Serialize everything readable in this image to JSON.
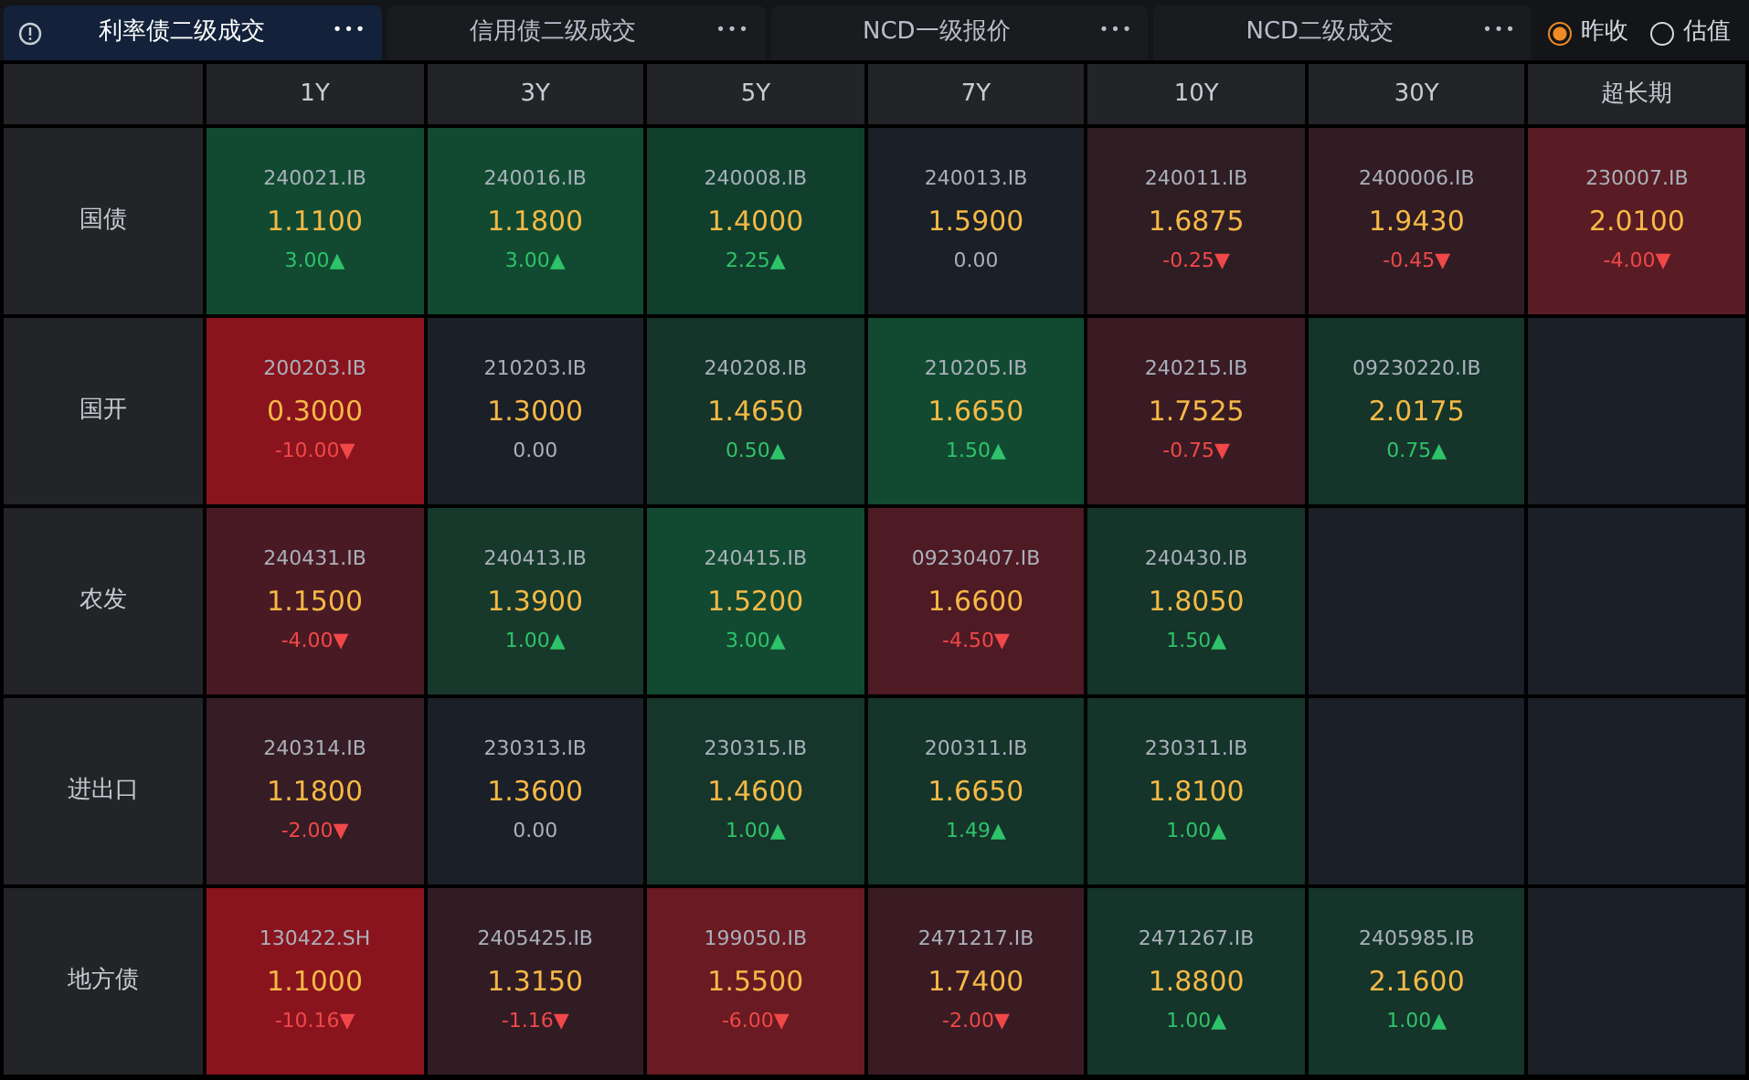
{
  "tabs": [
    {
      "label": "利率债二级成交",
      "more": "•••",
      "selected": true,
      "alert": true
    },
    {
      "label": "信用债二级成交",
      "more": "•••",
      "selected": false,
      "alert": false
    },
    {
      "label": "NCD一级报价",
      "more": "•••",
      "selected": false,
      "alert": false
    },
    {
      "label": "NCD二级成交",
      "more": "•••",
      "selected": false,
      "alert": false
    }
  ],
  "price_basis": [
    {
      "label": "昨收",
      "selected": true
    },
    {
      "label": "估值",
      "selected": false
    }
  ],
  "columns": [
    "1Y",
    "3Y",
    "5Y",
    "7Y",
    "10Y",
    "30Y",
    "超长期"
  ],
  "rows": [
    {
      "label": "国债",
      "cells": [
        {
          "code": "240021.IB",
          "yield": "1.1100",
          "change": "3.00▲",
          "kind": "up",
          "color": "#114a31"
        },
        {
          "code": "240016.IB",
          "yield": "1.1800",
          "change": "3.00▲",
          "kind": "up",
          "color": "#114a31"
        },
        {
          "code": "240008.IB",
          "yield": "1.4000",
          "change": "2.25▲",
          "kind": "up",
          "color": "#103f2d"
        },
        {
          "code": "240013.IB",
          "yield": "1.5900",
          "change": "0.00",
          "kind": "flat",
          "color": "#1b1f27"
        },
        {
          "code": "240011.IB",
          "yield": "1.6875",
          "change": "-0.25▼",
          "kind": "down",
          "color": "#2f1d24"
        },
        {
          "code": "2400006.IB",
          "yield": "1.9430",
          "change": "-0.45▼",
          "kind": "down",
          "color": "#321c24"
        },
        {
          "code": "230007.IB",
          "yield": "2.0100",
          "change": "-4.00▼",
          "kind": "down",
          "color": "#5a1c24"
        }
      ]
    },
    {
      "label": "国开",
      "cells": [
        {
          "code": "200203.IB",
          "yield": "0.3000",
          "change": "-10.00▼",
          "kind": "down",
          "color": "#8a141e"
        },
        {
          "code": "210203.IB",
          "yield": "1.3000",
          "change": "0.00",
          "kind": "flat",
          "color": "#1b1f27"
        },
        {
          "code": "240208.IB",
          "yield": "1.4650",
          "change": "0.50▲",
          "kind": "up",
          "color": "#15342a"
        },
        {
          "code": "210205.IB",
          "yield": "1.6650",
          "change": "1.50▲",
          "kind": "up",
          "color": "#114a31"
        },
        {
          "code": "240215.IB",
          "yield": "1.7525",
          "change": "-0.75▼",
          "kind": "down",
          "color": "#3a1b24"
        },
        {
          "code": "09230220.IB",
          "yield": "2.0175",
          "change": "0.75▲",
          "kind": "up",
          "color": "#15342a"
        }
      ]
    },
    {
      "label": "农发",
      "cells": [
        {
          "code": "240431.IB",
          "yield": "1.1500",
          "change": "-4.00▼",
          "kind": "down",
          "color": "#4a1a24"
        },
        {
          "code": "240413.IB",
          "yield": "1.3900",
          "change": "1.00▲",
          "kind": "up",
          "color": "#17392c"
        },
        {
          "code": "240415.IB",
          "yield": "1.5200",
          "change": "3.00▲",
          "kind": "up",
          "color": "#114a31"
        },
        {
          "code": "09230407.IB",
          "yield": "1.6600",
          "change": "-4.50▼",
          "kind": "down",
          "color": "#4e1a24"
        },
        {
          "code": "240430.IB",
          "yield": "1.8050",
          "change": "1.50▲",
          "kind": "up",
          "color": "#15342a"
        }
      ]
    },
    {
      "label": "进出口",
      "cells": [
        {
          "code": "240314.IB",
          "yield": "1.1800",
          "change": "-2.00▼",
          "kind": "down",
          "color": "#361c24"
        },
        {
          "code": "230313.IB",
          "yield": "1.3600",
          "change": "0.00",
          "kind": "flat",
          "color": "#1b1f27"
        },
        {
          "code": "230315.IB",
          "yield": "1.4600",
          "change": "1.00▲",
          "kind": "up",
          "color": "#16362b"
        },
        {
          "code": "200311.IB",
          "yield": "1.6650",
          "change": "1.49▲",
          "kind": "up",
          "color": "#15342a"
        },
        {
          "code": "230311.IB",
          "yield": "1.8100",
          "change": "1.00▲",
          "kind": "up",
          "color": "#15342a"
        }
      ]
    },
    {
      "label": "地方债",
      "cells": [
        {
          "code": "130422.SH",
          "yield": "1.1000",
          "change": "-10.16▼",
          "kind": "down",
          "color": "#8a141e"
        },
        {
          "code": "2405425.IB",
          "yield": "1.3150",
          "change": "-1.16▼",
          "kind": "down",
          "color": "#321c24"
        },
        {
          "code": "199050.IB",
          "yield": "1.5500",
          "change": "-6.00▼",
          "kind": "down",
          "color": "#6a1a22"
        },
        {
          "code": "2471217.IB",
          "yield": "1.7400",
          "change": "-2.00▼",
          "kind": "down",
          "color": "#3a1b24"
        },
        {
          "code": "2471267.IB",
          "yield": "1.8800",
          "change": "1.00▲",
          "kind": "up",
          "color": "#15342a"
        },
        {
          "code": "2405985.IB",
          "yield": "2.1600",
          "change": "1.00▲",
          "kind": "up",
          "color": "#15342a"
        }
      ]
    }
  ]
}
